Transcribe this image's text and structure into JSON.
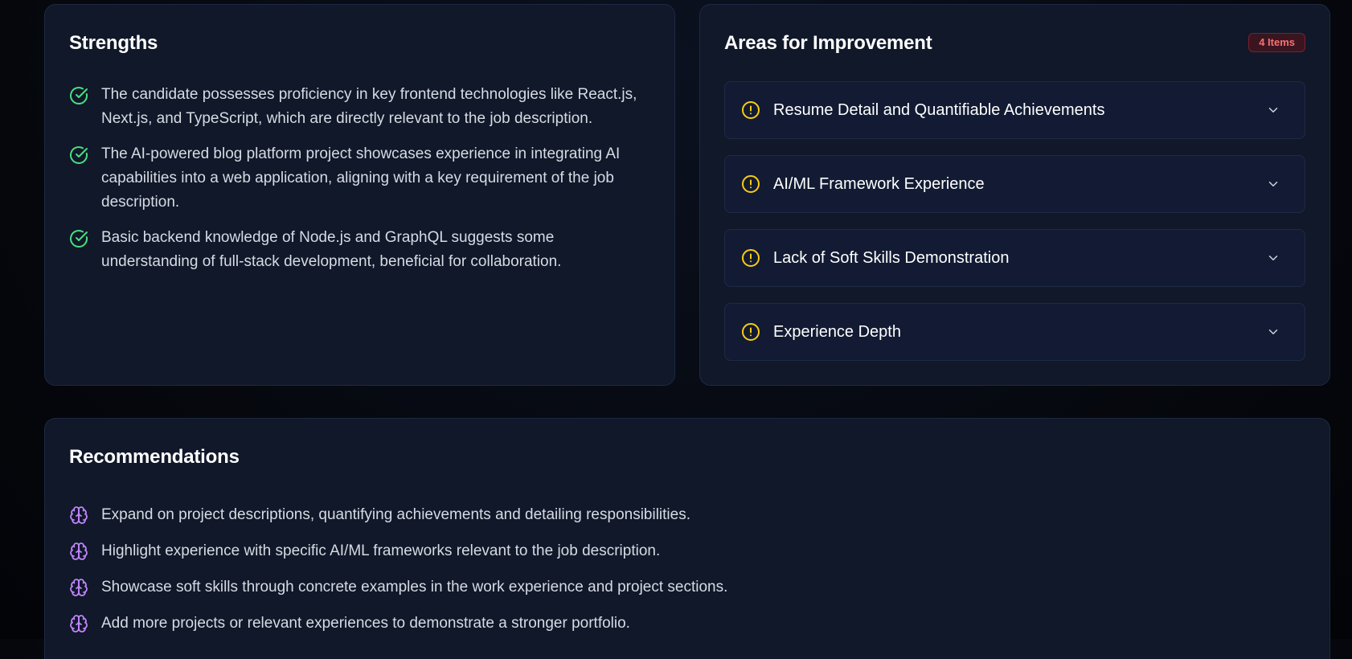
{
  "strengths": {
    "title": "Strengths",
    "items": [
      {
        "icon": "check-circle-icon",
        "text": "The candidate possesses proficiency in key frontend technologies like React.js, Next.js, and TypeScript, which are directly relevant to the job description."
      },
      {
        "icon": "check-circle-icon",
        "text": "The AI-powered blog platform project showcases experience in integrating AI capabilities into a web application, aligning with a key requirement of the job description."
      },
      {
        "icon": "check-circle-icon",
        "text": "Basic backend knowledge of Node.js and GraphQL suggests some understanding of full-stack development, beneficial for collaboration."
      }
    ]
  },
  "improvement": {
    "title": "Areas for Improvement",
    "badge": "4 Items",
    "items": [
      {
        "icon": "warning-circle-icon",
        "label": "Resume Detail and Quantifiable Achievements"
      },
      {
        "icon": "warning-circle-icon",
        "label": "AI/ML Framework Experience"
      },
      {
        "icon": "warning-circle-icon",
        "label": "Lack of Soft Skills Demonstration"
      },
      {
        "icon": "warning-circle-icon",
        "label": "Experience Depth"
      }
    ]
  },
  "recommendations": {
    "title": "Recommendations",
    "items": [
      {
        "icon": "brain-icon",
        "text": "Expand on project descriptions, quantifying achievements and detailing responsibilities."
      },
      {
        "icon": "brain-icon",
        "text": "Highlight experience with specific AI/ML frameworks relevant to the job description."
      },
      {
        "icon": "brain-icon",
        "text": "Showcase soft skills through concrete examples in the work experience and project sections."
      },
      {
        "icon": "brain-icon",
        "text": "Add more projects or relevant experiences to demonstrate a stronger portfolio."
      }
    ]
  },
  "colors": {
    "success": "#4ade80",
    "warning": "#facc15",
    "accent": "#c084fc",
    "badge_text": "#f87171",
    "card_bg": "#101829"
  }
}
